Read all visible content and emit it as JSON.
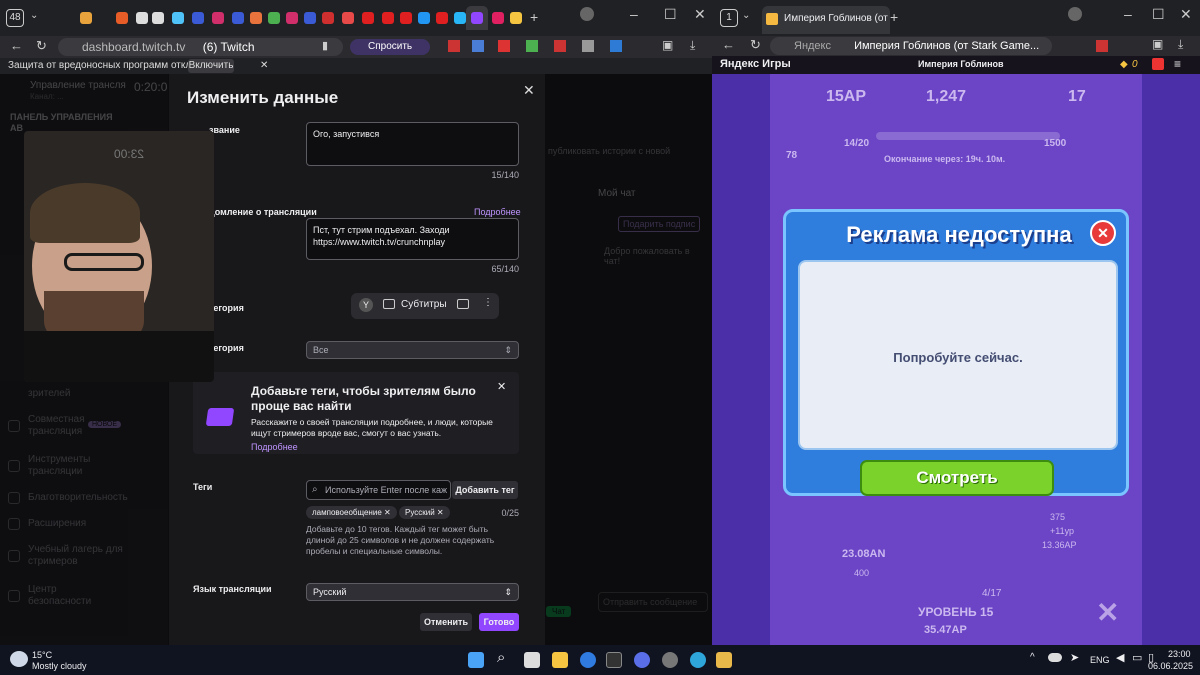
{
  "left_browser": {
    "tab_count": "48",
    "address": {
      "url": "dashboard.twitch.tv",
      "page_title": "(6) Twitch",
      "ask_label": "Спросить"
    },
    "warning": {
      "text": "Защита от вредоносных программ отключена",
      "enable_label": "Включить"
    },
    "dashboard": {
      "header_line1": "Управление трансля",
      "header_line2": "Канал: ...",
      "timer": "0:20:0",
      "panel_title": "ПАНЕЛЬ УПРАВЛЕНИЯ",
      "panel_sub": "АВ",
      "sidebar_items": [
        "зрителей",
        "Совместная трансляция",
        "Инструменты трансляции",
        "Благотворительность",
        "Расширения",
        "Учебный лагерь для стримеров",
        "Центр безопасности"
      ],
      "new_badge": "НОВОЕ",
      "my_chat": "Мой чат",
      "pin_label": "Подарить подпис",
      "chat_welcome": "Добро пожаловать в чат!",
      "send_placeholder": "Отправить сообщение",
      "chat_btn": "Чат",
      "share_hint": "публиковать истории с новой"
    }
  },
  "modal": {
    "title": "Изменить данные",
    "title_label": "звание",
    "title_value": "Ого, запустився",
    "title_count": "15/140",
    "notif_label": "домление о трансляции",
    "notif_more": "Подробнее",
    "notif_value": "Пст, тут стрим подъехал. Заходи https://www.twitch.tv/crunchnplay",
    "notif_count": "65/140",
    "category_label": "тегория",
    "overlay_subtitles": "Субтитры",
    "content_label": "тегория",
    "content_value": "Все",
    "promo_title": "Добавьте теги, чтобы зрителям было проще вас найти",
    "promo_text": "Расскажите о своей трансляции подробнее, и люди, которые ищут стримеров вроде вас, смогут о вас узнать.",
    "promo_link": "Подробнее",
    "tags_label": "Теги",
    "tags_placeholder": "Используйте Enter после каж",
    "add_tag": "Добавить тег",
    "tags": [
      "ламповоеобщение",
      "Русский"
    ],
    "tags_count": "0/25",
    "tags_hint": "Добавьте до 10 тегов. Каждый тег может быть длиной до 25 символов и не должен содержать пробелы и специальные символы.",
    "lang_label": "Язык трансляции",
    "lang_value": "Русский",
    "cancel": "Отменить",
    "done": "Готово"
  },
  "webcam": {
    "clock": "23:00"
  },
  "right_browser": {
    "tab_count": "1",
    "tab_title": "Империя Гоблинов (от",
    "address_site": "Яндекс",
    "address_title": "Империя Гоблинов (от Stark Game...",
    "brand": "Яндекс Игры",
    "game_title": "Империя Гоблинов",
    "coins": "0"
  },
  "game": {
    "top_stats": [
      "15AP",
      "1,247",
      "17"
    ],
    "progress": "14/20",
    "progress_right": "1500",
    "level_circle": "78",
    "timer_text": "Окончание через: 19ч. 10м.",
    "bottom_value": "23.08AN",
    "bottom_small": "400",
    "level_text": "УРОВЕНЬ 15",
    "level_value": "35.47AP",
    "level_progress": "4/17",
    "right_vals": [
      "375",
      "+11ур",
      "13.36AP"
    ],
    "dialog": {
      "title": "Реклама недоступна",
      "message": "Попробуйте сейчас.",
      "button": "Смотреть"
    }
  },
  "taskbar": {
    "weather_temp": "15°C",
    "weather_desc": "Mostly cloudy",
    "lang": "ENG",
    "time": "23:00",
    "date": "06.06.2025"
  }
}
